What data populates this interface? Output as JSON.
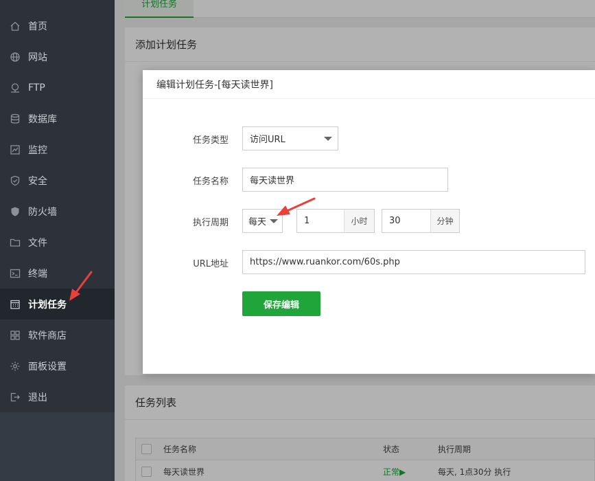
{
  "sidebar": {
    "items": [
      {
        "label": "首页",
        "icon": "home-icon"
      },
      {
        "label": "网站",
        "icon": "globe-icon"
      },
      {
        "label": "FTP",
        "icon": "ftp-icon"
      },
      {
        "label": "数据库",
        "icon": "database-icon"
      },
      {
        "label": "监控",
        "icon": "monitor-icon"
      },
      {
        "label": "安全",
        "icon": "shield-check-icon"
      },
      {
        "label": "防火墙",
        "icon": "shield-icon"
      },
      {
        "label": "文件",
        "icon": "folder-icon"
      },
      {
        "label": "终端",
        "icon": "terminal-icon"
      },
      {
        "label": "计划任务",
        "icon": "calendar-icon",
        "active": true
      },
      {
        "label": "软件商店",
        "icon": "grid-icon"
      },
      {
        "label": "面板设置",
        "icon": "gear-icon"
      },
      {
        "label": "退出",
        "icon": "logout-icon"
      }
    ]
  },
  "tabs": {
    "active_label": "计划任务"
  },
  "panel_add": {
    "title": "添加计划任务"
  },
  "modal": {
    "title": "编辑计划任务-[每天读世界]",
    "task_type_label": "任务类型",
    "task_type_value": "访问URL",
    "task_name_label": "任务名称",
    "task_name_value": "每天读世界",
    "cycle_label": "执行周期",
    "cycle_value": "每天",
    "hour_value": "1",
    "hour_unit": "小时",
    "minute_value": "30",
    "minute_unit": "分钟",
    "url_label": "URL地址",
    "url_value": "https://www.ruankor.com/60s.php",
    "save_label": "保存编辑"
  },
  "task_list": {
    "title": "任务列表",
    "columns": [
      "任务名称",
      "状态",
      "执行周期"
    ],
    "rows": [
      {
        "name": "每天读世界",
        "status": "正常▶",
        "cycle": "每天, 1点30分 执行"
      }
    ]
  },
  "colors": {
    "accent": "#20a53a",
    "sidebar_bg": "#2d3139",
    "arrow": "#e8413b"
  }
}
